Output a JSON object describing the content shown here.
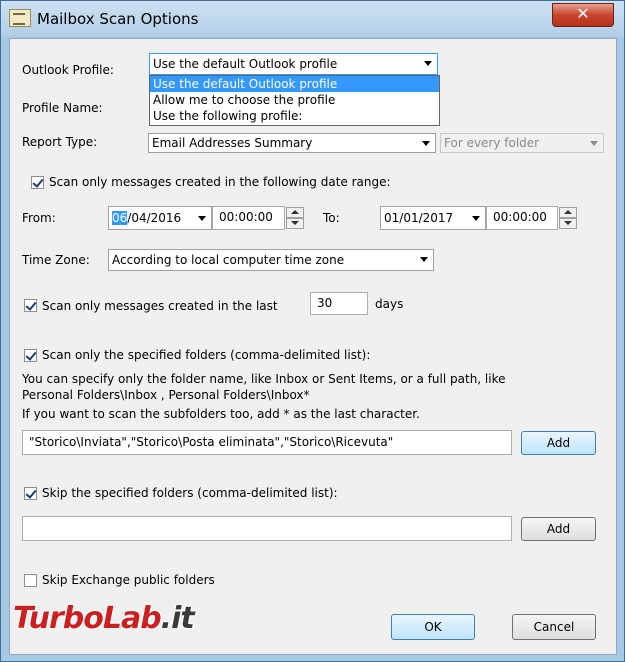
{
  "window": {
    "title": "Mailbox Scan Options",
    "close_glyph": "✕"
  },
  "outlook_profile": {
    "label": "Outlook Profile:",
    "value": "Use the default Outlook profile",
    "options": [
      "Use the default Outlook profile",
      "Allow me to choose the profile",
      "Use the following profile:"
    ]
  },
  "profile_name": {
    "label": "Profile Name:"
  },
  "report_type": {
    "label": "Report Type:",
    "value": "Email Addresses Summary",
    "scope_value": "For every folder"
  },
  "date_range": {
    "checkbox_label": "Scan only messages created in the following date range:",
    "checked": true,
    "from_label": "From:",
    "from_date_day": "06",
    "from_date_rest": "/04/2016",
    "from_time": "00:00:00",
    "to_label": "To:",
    "to_date": "01/01/2017",
    "to_time": "00:00:00"
  },
  "time_zone": {
    "label": "Time Zone:",
    "value": "According to local computer time zone"
  },
  "last_days": {
    "checkbox_label": "Scan only messages created in the last",
    "checked": true,
    "value": "30",
    "unit": "days"
  },
  "specified_folders": {
    "checkbox_label": "Scan only the specified folders (comma-delimited list):",
    "checked": true,
    "help_line1": "You can specify only the folder name, like Inbox or Sent Items, or a full path, like",
    "help_line2": "Personal Folders\\Inbox , Personal Folders\\Inbox*",
    "help_line3": "If you want to scan the subfolders too, add * as the last character.",
    "value": "\"Storico\\Inviata\",\"Storico\\Posta eliminata\",\"Storico\\Ricevuta\"",
    "add_label": "Add"
  },
  "skip_folders": {
    "checkbox_label": "Skip the specified folders (comma-delimited list):",
    "checked": true,
    "value": "",
    "add_label": "Add"
  },
  "skip_exchange": {
    "checkbox_label": "Skip Exchange public folders",
    "checked": false
  },
  "buttons": {
    "ok": "OK",
    "cancel": "Cancel"
  },
  "watermark": {
    "part1": "TurboLab",
    "part2": ".it"
  }
}
